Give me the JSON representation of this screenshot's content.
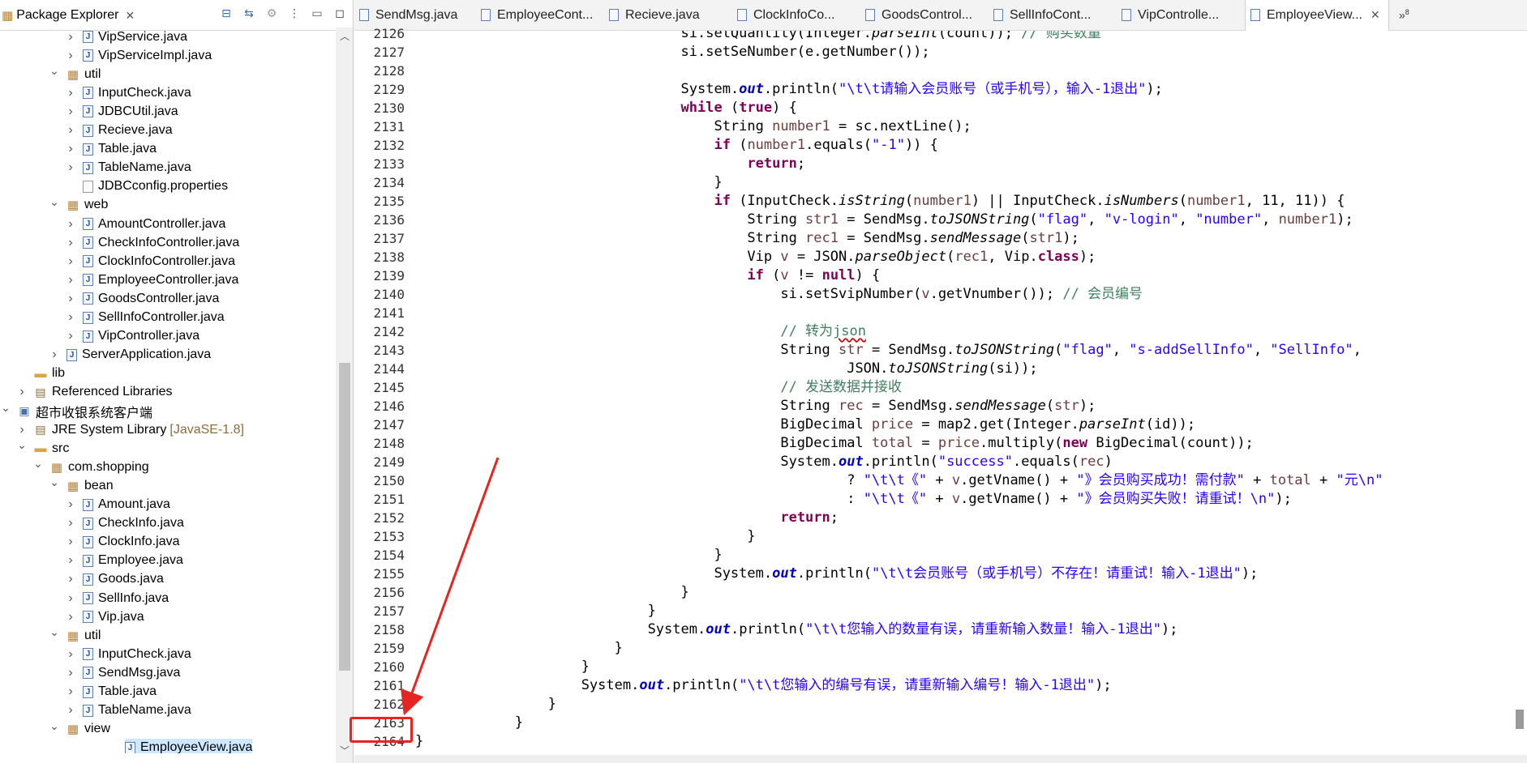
{
  "explorer": {
    "title": "Package Explorer",
    "tree": [
      {
        "label": "VipService.java",
        "icon": "java-file-icon",
        "twisty": ">",
        "indent": 80
      },
      {
        "label": "VipServiceImpl.java",
        "icon": "java-file-icon",
        "twisty": ">",
        "indent": 80
      },
      {
        "label": "util",
        "icon": "package-icon",
        "twisty": "v",
        "indent": 60
      },
      {
        "label": "InputCheck.java",
        "icon": "java-file-icon",
        "twisty": ">",
        "indent": 80
      },
      {
        "label": "JDBCUtil.java",
        "icon": "java-file-icon",
        "twisty": ">",
        "indent": 80
      },
      {
        "label": "Recieve.java",
        "icon": "java-file-icon",
        "twisty": ">",
        "indent": 80
      },
      {
        "label": "Table.java",
        "icon": "java-file-icon",
        "twisty": ">",
        "indent": 80
      },
      {
        "label": "TableName.java",
        "icon": "java-file-icon",
        "twisty": ">",
        "indent": 80
      },
      {
        "label": "JDBCconfig.properties",
        "icon": "properties-file-icon",
        "twisty": "",
        "indent": 80
      },
      {
        "label": "web",
        "icon": "package-icon",
        "twisty": "v",
        "indent": 60
      },
      {
        "label": "AmountController.java",
        "icon": "java-file-icon",
        "twisty": ">",
        "indent": 80
      },
      {
        "label": "CheckInfoController.java",
        "icon": "java-file-icon",
        "twisty": ">",
        "indent": 80
      },
      {
        "label": "ClockInfoController.java",
        "icon": "java-file-icon",
        "twisty": ">",
        "indent": 80
      },
      {
        "label": "EmployeeController.java",
        "icon": "java-file-icon",
        "twisty": ">",
        "indent": 80
      },
      {
        "label": "GoodsController.java",
        "icon": "java-file-icon",
        "twisty": ">",
        "indent": 80
      },
      {
        "label": "SellInfoController.java",
        "icon": "java-file-icon",
        "twisty": ">",
        "indent": 80
      },
      {
        "label": "VipController.java",
        "icon": "java-file-icon",
        "twisty": ">",
        "indent": 80
      },
      {
        "label": "ServerApplication.java",
        "icon": "java-file-icon",
        "twisty": ">",
        "indent": 60
      },
      {
        "label": "lib",
        "icon": "folder-icon",
        "twisty": "",
        "indent": 20
      },
      {
        "label": "Referenced Libraries",
        "icon": "library-icon",
        "twisty": ">",
        "indent": 20
      },
      {
        "label": "超市收银系统客户端",
        "icon": "project-icon",
        "twisty": "v",
        "indent": 0
      },
      {
        "label": "JRE System Library",
        "extra": "[JavaSE-1.8]",
        "icon": "library-icon",
        "twisty": ">",
        "indent": 20
      },
      {
        "label": "src",
        "icon": "folder-icon",
        "twisty": "v",
        "indent": 20
      },
      {
        "label": "com.shopping",
        "icon": "package-icon",
        "twisty": "v",
        "indent": 40
      },
      {
        "label": "bean",
        "icon": "package-icon",
        "twisty": "v",
        "indent": 60
      },
      {
        "label": "Amount.java",
        "icon": "java-file-icon",
        "twisty": ">",
        "indent": 80
      },
      {
        "label": "CheckInfo.java",
        "icon": "java-file-icon",
        "twisty": ">",
        "indent": 80
      },
      {
        "label": "ClockInfo.java",
        "icon": "java-file-icon",
        "twisty": ">",
        "indent": 80
      },
      {
        "label": "Employee.java",
        "icon": "java-file-icon",
        "twisty": ">",
        "indent": 80
      },
      {
        "label": "Goods.java",
        "icon": "java-file-icon",
        "twisty": ">",
        "indent": 80
      },
      {
        "label": "SellInfo.java",
        "icon": "java-file-icon",
        "twisty": ">",
        "indent": 80
      },
      {
        "label": "Vip.java",
        "icon": "java-file-icon",
        "twisty": ">",
        "indent": 80
      },
      {
        "label": "util",
        "icon": "package-icon",
        "twisty": "v",
        "indent": 60
      },
      {
        "label": "InputCheck.java",
        "icon": "java-file-icon",
        "twisty": ">",
        "indent": 80
      },
      {
        "label": "SendMsg.java",
        "icon": "java-file-icon",
        "twisty": ">",
        "indent": 80
      },
      {
        "label": "Table.java",
        "icon": "java-file-icon",
        "twisty": ">",
        "indent": 80
      },
      {
        "label": "TableName.java",
        "icon": "java-file-icon",
        "twisty": ">",
        "indent": 80
      },
      {
        "label": "view",
        "icon": "package-icon",
        "twisty": "v",
        "indent": 60
      },
      {
        "label": "EmployeeView.java",
        "icon": "java-file-icon",
        "twisty": ">",
        "indent": 80,
        "selected": true
      }
    ]
  },
  "editor": {
    "tabs": [
      {
        "label": "SendMsg.java"
      },
      {
        "label": "EmployeeCont..."
      },
      {
        "label": "Recieve.java"
      },
      {
        "label": "ClockInfoCo..."
      },
      {
        "label": "GoodsControl..."
      },
      {
        "label": "SellInfoCont..."
      },
      {
        "label": "VipControlle..."
      },
      {
        "label": "EmployeeView...",
        "active": true
      }
    ],
    "more_label": "»",
    "more_count": "8",
    "line_numbers": [
      "2126",
      "2127",
      "2128",
      "2129",
      "2130",
      "2131",
      "2132",
      "2133",
      "2134",
      "2135",
      "2136",
      "2137",
      "2138",
      "2139",
      "2140",
      "2141",
      "2142",
      "2143",
      "2144",
      "2145",
      "2146",
      "2147",
      "2148",
      "2149",
      "2150",
      "2151",
      "2152",
      "2153",
      "2154",
      "2155",
      "2156",
      "2157",
      "2158",
      "2159",
      "2160",
      "2161",
      "2162",
      "2163",
      "2164"
    ],
    "highlighted_line": "2164",
    "code_lines": [
      "                                si.setQuantity(Integer.parseInt(count)); // 购买数量",
      "                                si.setSeNumber(e.getNumber());",
      "",
      "                                System.out.println(\"\\t\\t请输入会员账号（或手机号），输入-1退出\");",
      "                                while (true) {",
      "                                    String number1 = sc.nextLine();",
      "                                    if (number1.equals(\"-1\")) {",
      "                                        return;",
      "                                    }",
      "                                    if (InputCheck.isString(number1) || InputCheck.isNumbers(number1, 11, 11)) {",
      "                                        String str1 = SendMsg.toJSONString(\"flag\", \"v-login\", \"number\", number1);",
      "                                        String rec1 = SendMsg.sendMessage(str1);",
      "                                        Vip v = JSON.parseObject(rec1, Vip.class);",
      "                                        if (v != null) {",
      "                                            si.setSvipNumber(v.getVnumber()); // 会员编号",
      "",
      "                                            // 转为json",
      "                                            String str = SendMsg.toJSONString(\"flag\", \"s-addSellInfo\", \"SellInfo\",",
      "                                                    JSON.toJSONString(si));",
      "                                            // 发送数据并接收",
      "                                            String rec = SendMsg.sendMessage(str);",
      "                                            BigDecimal price = map2.get(Integer.parseInt(id));",
      "                                            BigDecimal total = price.multiply(new BigDecimal(count));",
      "                                            System.out.println(\"success\".equals(rec)",
      "                                                    ? \"\\t\\t《\" + v.getVname() + \"》会员购买成功！需付款\" + total + \"元\\n\"",
      "                                                    : \"\\t\\t《\" + v.getVname() + \"》会员购买失败！请重试！\\n\");",
      "                                            return;",
      "                                        }",
      "                                    }",
      "                                    System.out.println(\"\\t\\t会员账号（或手机号）不存在！请重试！输入-1退出\");",
      "                                }",
      "                            }",
      "                            System.out.println(\"\\t\\t您输入的数量有误，请重新输入数量！输入-1退出\");",
      "                        }",
      "                    }",
      "                    System.out.println(\"\\t\\t您输入的编号有误，请重新输入编号！输入-1退出\");",
      "                }",
      "            }",
      "}"
    ]
  },
  "colors": {
    "keyword": "#7f0055",
    "string": "#2a00ff",
    "comment": "#3f7f5f",
    "static_field": "#0000c0",
    "annotation_red": "#e52521",
    "selection": "#cde8ff"
  }
}
